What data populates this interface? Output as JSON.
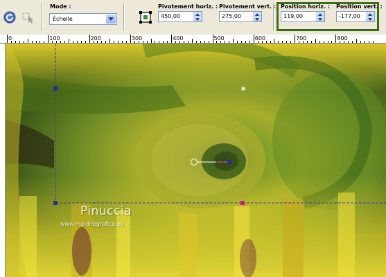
{
  "toolbar": {
    "mode_label": "Mode :",
    "mode_value": "Échelle",
    "pivot_h_label": "Pivotement horiz. :",
    "pivot_h_value": "450,00",
    "pivot_v_label": "Pivotement vert. :",
    "pivot_v_value": "275,00",
    "pos_h_label": "Position horiz. :",
    "pos_h_value": "119,00",
    "pos_v_label": "Position vert. :",
    "pos_v_value": "-177,00",
    "icons": [
      "reset-arrow-icon",
      "move-tool-icon",
      "pick-tool-icon"
    ]
  },
  "ruler": {
    "labels": [
      "0",
      "100",
      "200",
      "300",
      "400",
      "500",
      "600",
      "700",
      "800"
    ]
  },
  "watermark": {
    "name": "Pinuccia",
    "url": "www.maidiregrafica.eu"
  },
  "colors": {
    "highlight_border": "#3d6b1c",
    "canvas_green": "#6a8f1e",
    "canvas_yellow": "#e2cf2a",
    "handle_blue": "#2b2b9a",
    "handle_magenta": "#d6128c"
  }
}
